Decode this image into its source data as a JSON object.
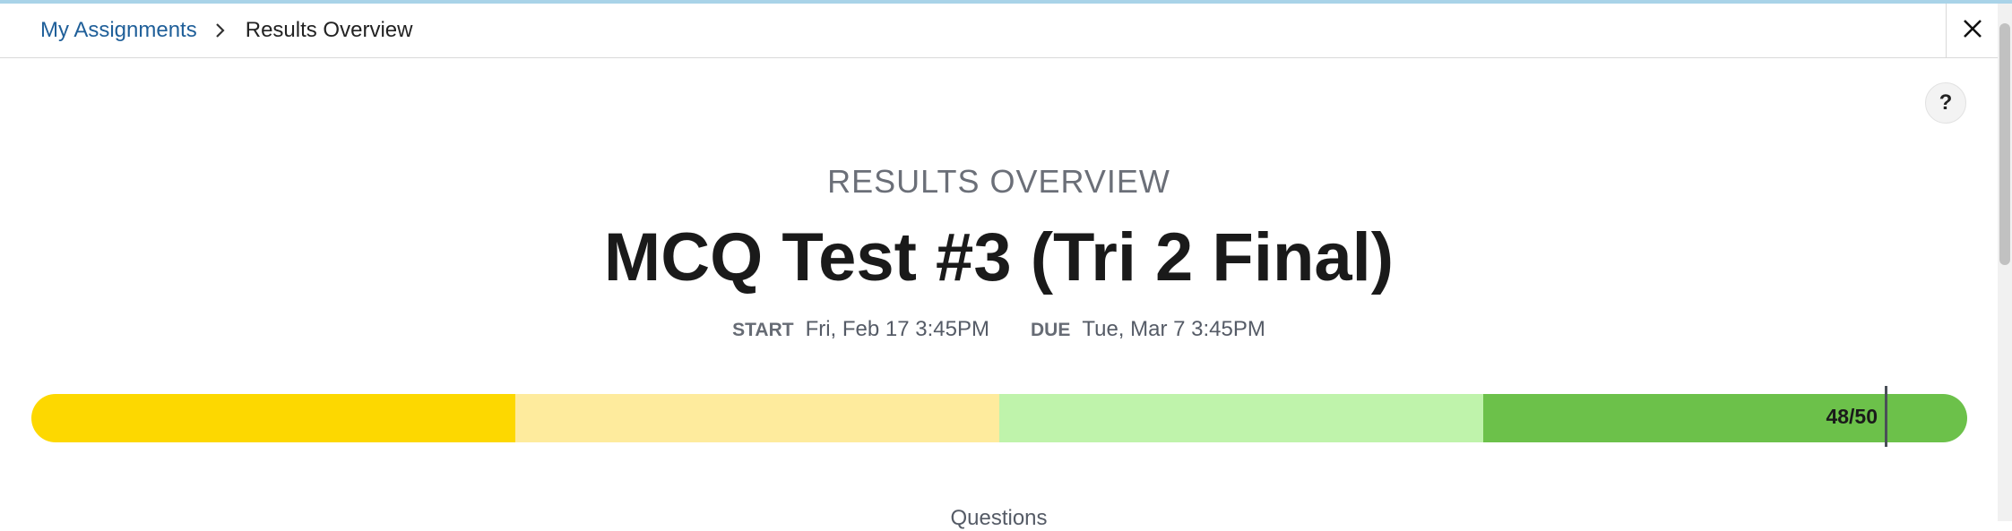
{
  "breadcrumb": {
    "parent": "My Assignments",
    "separator": ">",
    "current": "Results Overview"
  },
  "header": {
    "close_icon": "close-icon"
  },
  "help": {
    "label": "?"
  },
  "overview_label": "RESULTS OVERVIEW",
  "title": "MCQ Test #3 (Tri 2 Final)",
  "dates": {
    "start_key": "START",
    "start_value": "Fri, Feb 17 3:45PM",
    "due_key": "DUE",
    "due_value": "Tue, Mar 7 3:45PM"
  },
  "score": {
    "label": "48/50",
    "earned": 48,
    "total": 50
  },
  "score_bands": [
    {
      "color": "#fdd800",
      "share": 0.25
    },
    {
      "color": "#feeb9d",
      "share": 0.25
    },
    {
      "color": "#bff3ab",
      "share": 0.25
    },
    {
      "color": "#6cc14a",
      "share": 0.25
    }
  ],
  "questions_label": "Questions"
}
